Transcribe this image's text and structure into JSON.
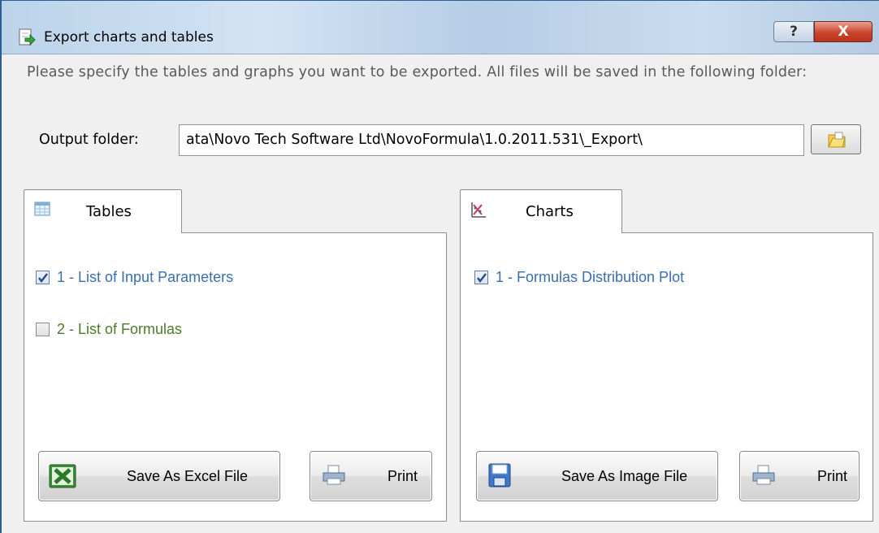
{
  "window": {
    "title": "Export charts and tables",
    "help_label": "?",
    "close_label": "X"
  },
  "instructions": "Please specify the tables and graphs you want to be exported. All files will be saved in the following folder:",
  "output": {
    "label": "Output folder:",
    "value": "ata\\Novo Tech Software Ltd\\NovoFormula\\1.0.2011.531\\_Export\\"
  },
  "tables": {
    "tab_label": "Tables",
    "items": [
      {
        "label": "1 - List of Input Parameters",
        "checked": true,
        "color": "#3a6fb0"
      },
      {
        "label": "2 - List of Formulas",
        "checked": false,
        "color": "#4f7a2a"
      }
    ],
    "save_label": "Save As Excel File",
    "print_label": "Print"
  },
  "charts": {
    "tab_label": "Charts",
    "items": [
      {
        "label": "1 - Formulas Distribution Plot",
        "checked": true,
        "color": "#3a6fb0"
      }
    ],
    "save_label": "Save As Image File",
    "print_label": "Print"
  },
  "icons": {
    "title": "export-arrow-icon",
    "browse": "folder-icon",
    "tables_tab": "table-icon",
    "charts_tab": "chart-icon",
    "excel": "excel-icon",
    "print": "printer-icon",
    "image": "floppy-disk-icon"
  }
}
